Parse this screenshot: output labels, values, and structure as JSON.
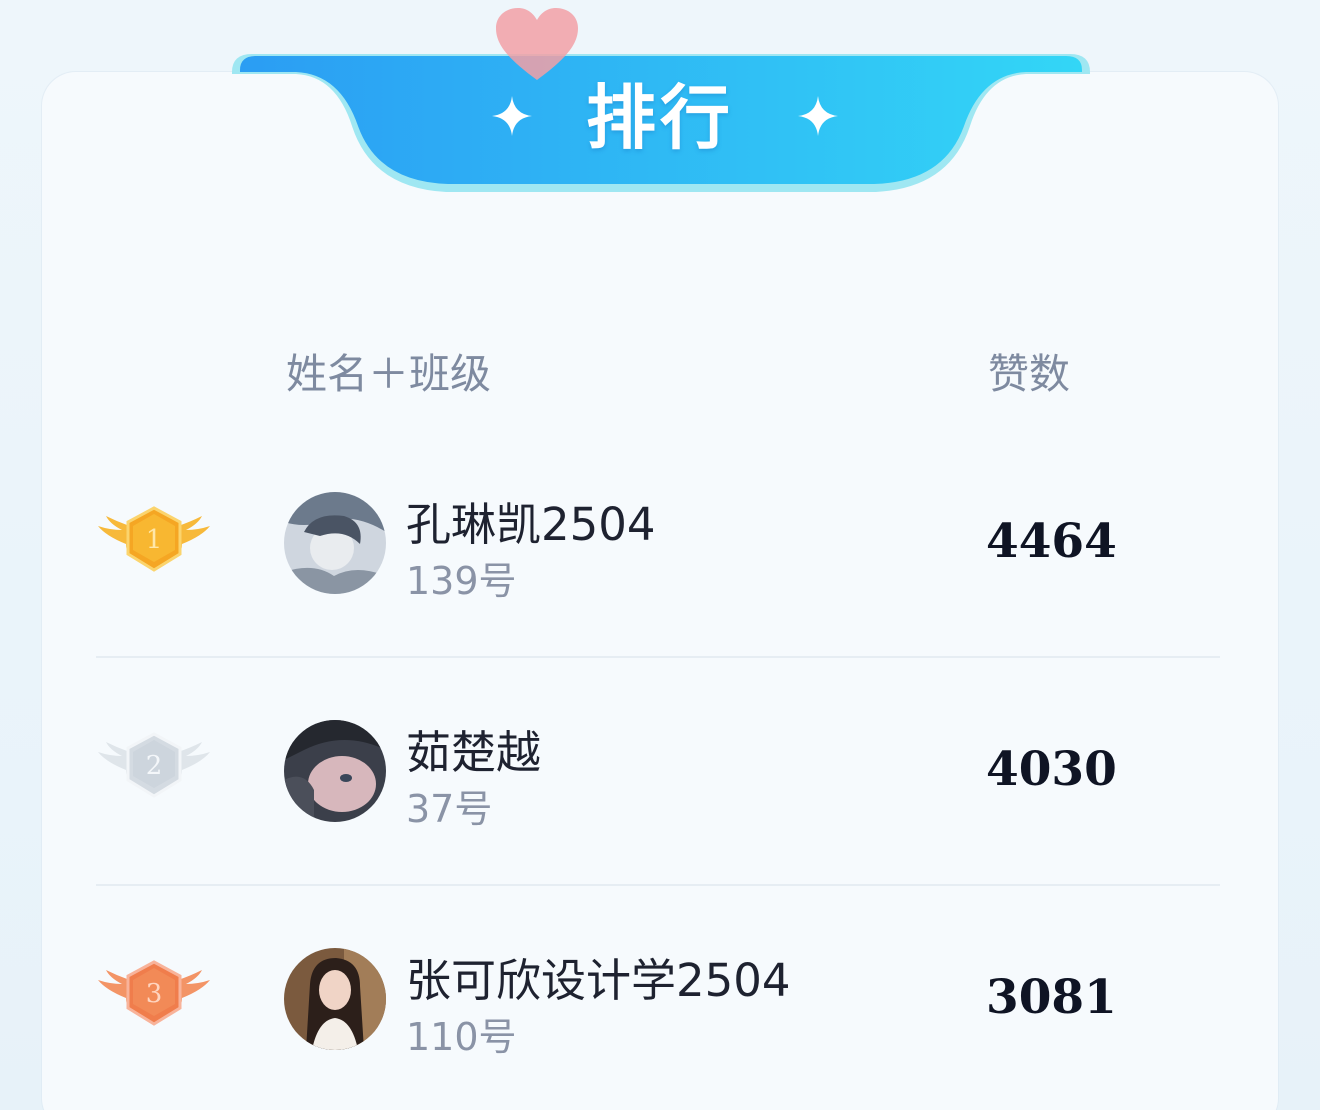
{
  "banner": {
    "title": "排行"
  },
  "header": {
    "name_col": "姓名＋班级",
    "likes_col": "赞数"
  },
  "colors": {
    "banner_blue": "#2aa5f4",
    "banner_cyan": "#36d4f4",
    "gold": "#f5a623",
    "silver": "#d4dbe2",
    "bronze": "#f07d4c"
  },
  "rows": [
    {
      "rank": "1",
      "medal_icon": "gold-winged-medal-icon",
      "avatar_icon": "user-avatar-icon",
      "name": "孔琳凯2504",
      "number": "139号",
      "likes": "4464"
    },
    {
      "rank": "2",
      "medal_icon": "silver-winged-medal-icon",
      "avatar_icon": "user-avatar-icon",
      "name": "茹楚越",
      "number": "37号",
      "likes": "4030"
    },
    {
      "rank": "3",
      "medal_icon": "bronze-winged-medal-icon",
      "avatar_icon": "user-avatar-icon",
      "name": "张可欣设计学2504",
      "number": "110号",
      "likes": "3081"
    }
  ]
}
